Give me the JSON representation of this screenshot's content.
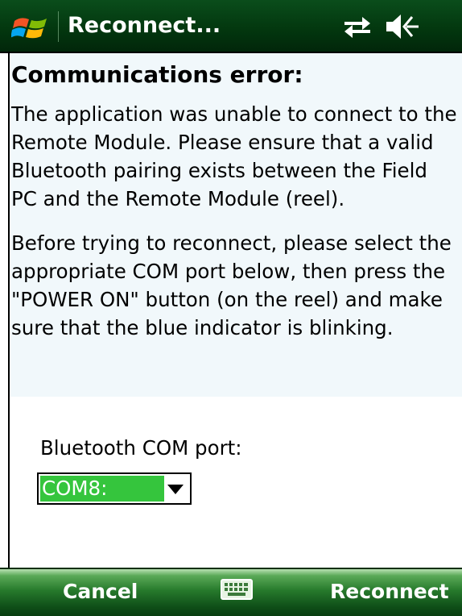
{
  "titlebar": {
    "title": "Reconnect...",
    "start_icon": "windows-start-flag-icon",
    "status_icons": [
      "connectivity-arrows-icon",
      "volume-muted-icon"
    ]
  },
  "content": {
    "heading": "Communications error:",
    "paragraph1": "The application was unable to connect to the Remote Module. Please ensure that a valid Bluetooth pairing exists between the Field PC and the Remote Module (reel).",
    "paragraph2": "Before trying to reconnect, please select the appropriate COM port below, then press the \"POWER ON\" button (on the reel) and make sure that the blue indicator is blinking.",
    "port_label": "Bluetooth COM port:",
    "port_value": "COM8:"
  },
  "softkeys": {
    "left": "Cancel",
    "right": "Reconnect",
    "center_icon": "keyboard-icon"
  },
  "colors": {
    "titlebar": "#03380f",
    "softbar": "#277a2c",
    "selection": "#35c53d",
    "panel": "#f1f8fb"
  }
}
